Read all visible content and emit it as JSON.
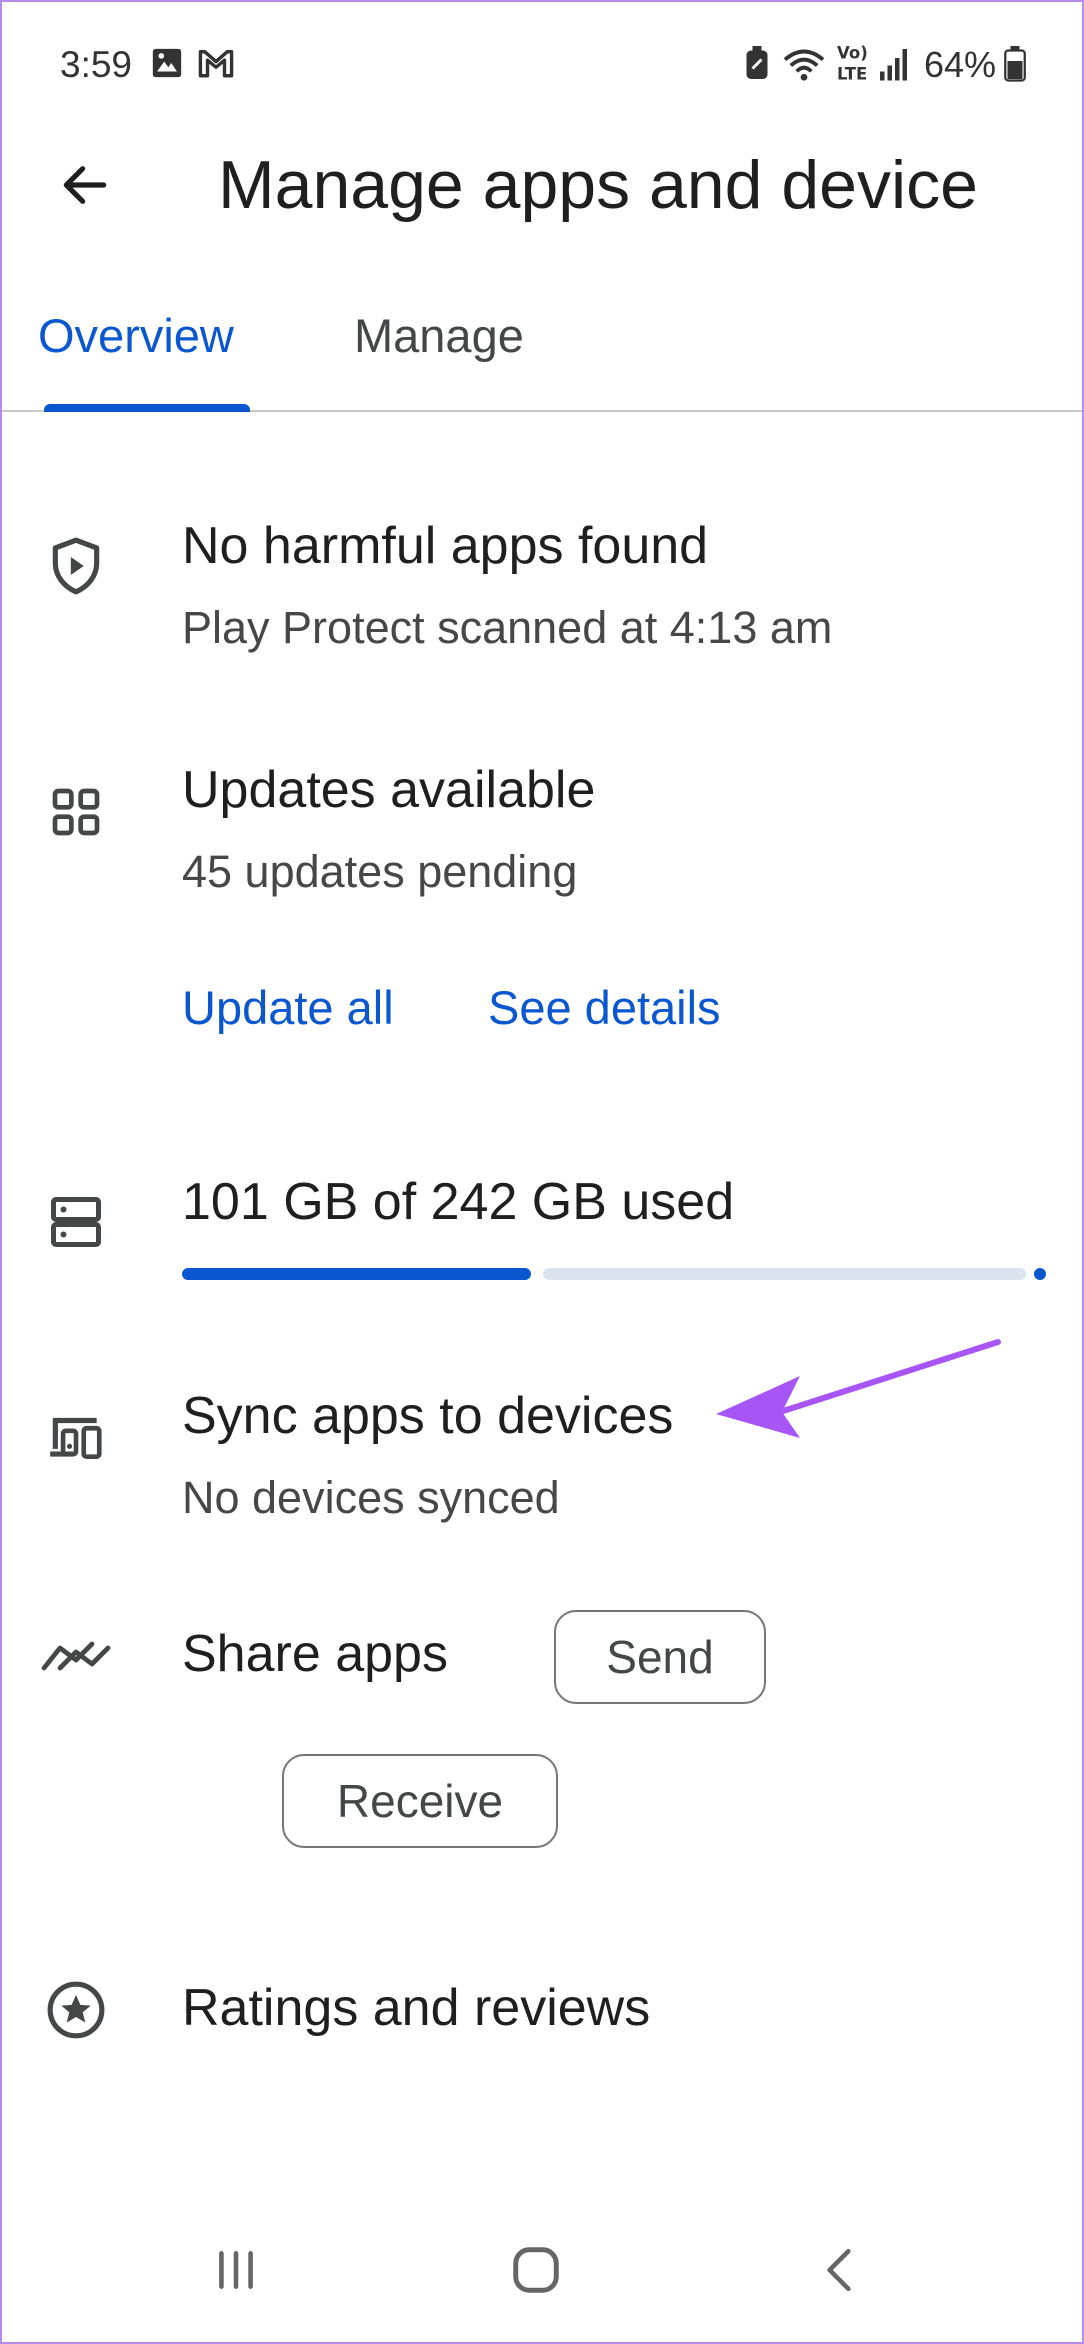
{
  "status_bar": {
    "time": "3:59",
    "battery": "64%",
    "icons": [
      "image-icon",
      "gmail-icon",
      "nfc-icon",
      "wifi-icon",
      "volte-icon",
      "signal-icon",
      "battery-icon"
    ]
  },
  "header": {
    "title": "Manage apps and device"
  },
  "tabs": [
    {
      "label": "Overview",
      "active": true
    },
    {
      "label": "Manage",
      "active": false
    }
  ],
  "protect": {
    "title": "No harmful apps found",
    "subtitle": "Play Protect scanned at 4:13 am",
    "icon": "play-protect-icon"
  },
  "updates": {
    "title": "Updates available",
    "subtitle": "45 updates pending",
    "update_all": "Update all",
    "see_details": "See details",
    "icon": "apps-grid-icon"
  },
  "storage": {
    "label": "101 GB of 242 GB used",
    "used_fraction": 0.417,
    "icon": "storage-icon"
  },
  "sync": {
    "title": "Sync apps to devices",
    "subtitle": "No devices synced",
    "icon": "devices-icon"
  },
  "share": {
    "title": "Share apps",
    "send": "Send",
    "receive": "Receive",
    "icon": "nearby-share-icon"
  },
  "ratings": {
    "title": "Ratings and reviews",
    "icon": "star-circle-icon"
  },
  "colors": {
    "accent": "#0b57d0",
    "annotation": "#a855f7"
  },
  "navigation": [
    "recents-button",
    "home-button",
    "back-button"
  ]
}
